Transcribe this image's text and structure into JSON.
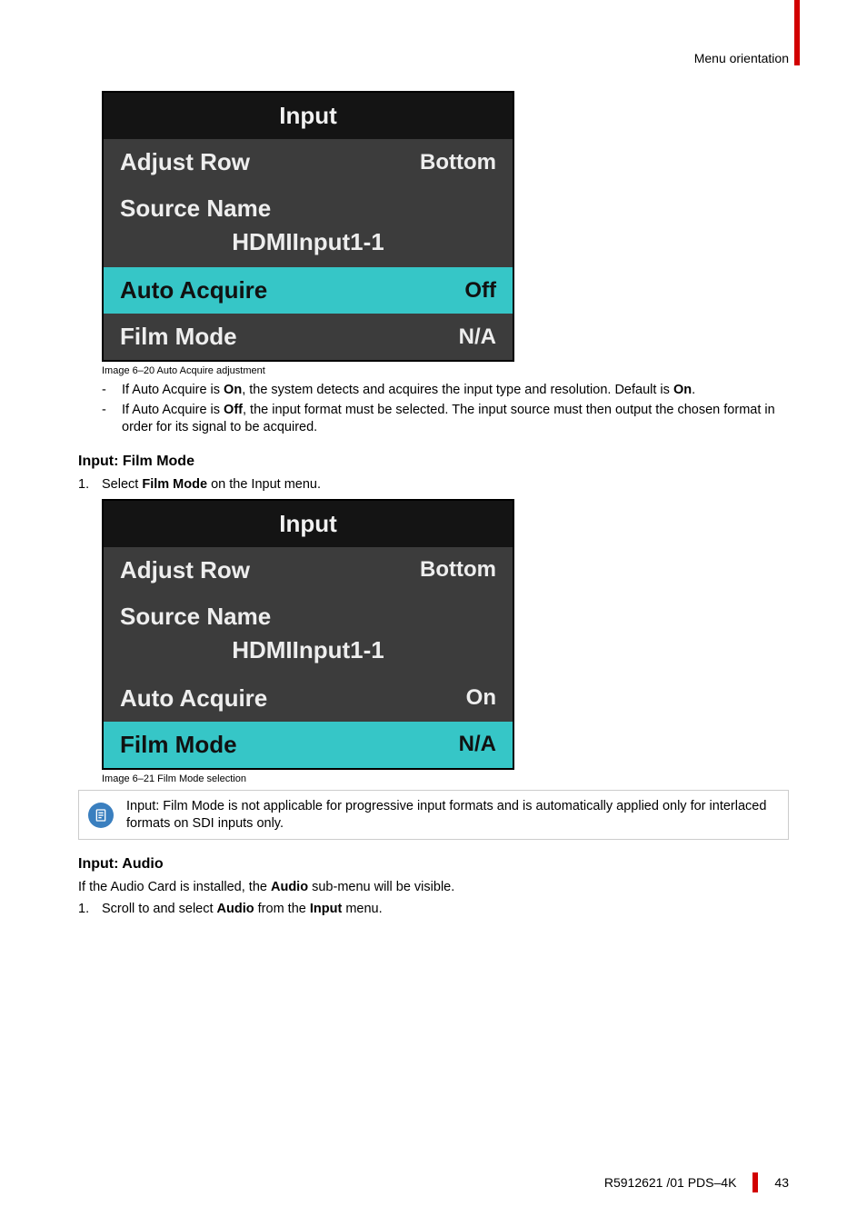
{
  "header": {
    "breadcrumb": "Menu orientation"
  },
  "panel1": {
    "title": "Input",
    "rows": {
      "adjust_label": "Adjust Row",
      "adjust_value": "Bottom",
      "source_label": "Source Name",
      "source_value": "HDMIInput1-1",
      "auto_label": "Auto Acquire",
      "auto_value": "Off",
      "film_label": "Film Mode",
      "film_value": "N/A"
    },
    "caption": "Image 6–20  Auto Acquire adjustment"
  },
  "bullets1": {
    "b1_pre": "If Auto Acquire is ",
    "b1_bold": "On",
    "b1_mid": ", the system detects and acquires the input type and resolution. Default is ",
    "b1_bold2": "On",
    "b1_post": ".",
    "b2_pre": "If Auto Acquire is ",
    "b2_bold": "Off",
    "b2_post": ", the input format must be selected. The input source must then output the chosen format in order for its signal to be acquired."
  },
  "section2": {
    "heading": "Input: Film Mode",
    "step_num": "1.",
    "step_pre": "Select ",
    "step_bold": "Film Mode",
    "step_post": " on the Input menu."
  },
  "panel2": {
    "title": "Input",
    "rows": {
      "adjust_label": "Adjust Row",
      "adjust_value": "Bottom",
      "source_label": "Source Name",
      "source_value": "HDMIInput1-1",
      "auto_label": "Auto Acquire",
      "auto_value": "On",
      "film_label": "Film Mode",
      "film_value": "N/A"
    },
    "caption": "Image 6–21  Film Mode selection"
  },
  "note": {
    "text": "Input: Film Mode is not applicable for progressive input formats and is automatically applied only for interlaced formats on SDI inputs only."
  },
  "section3": {
    "heading": "Input: Audio",
    "intro_pre": "If the Audio Card is installed, the ",
    "intro_bold": "Audio",
    "intro_post": " sub-menu will be visible.",
    "step_num": "1.",
    "step_pre": "Scroll to and select ",
    "step_bold1": "Audio",
    "step_mid": " from the ",
    "step_bold2": "Input",
    "step_post": " menu."
  },
  "footer": {
    "doc": "R5912621 /01 PDS–4K",
    "page": "43"
  }
}
